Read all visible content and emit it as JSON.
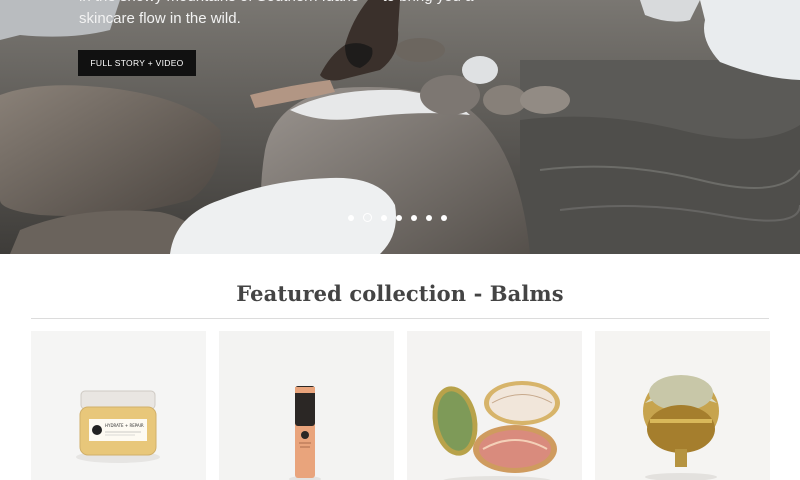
{
  "hero": {
    "text_line1": "in the snowy mountains of Southern Idaho — to bring you a",
    "text_line2": "skincare flow in the wild.",
    "button_label": "FULL STORY + VIDEO",
    "slides_total": 7,
    "active_slide": 2
  },
  "featured": {
    "title": "Featured collection - Balms",
    "products": [
      {
        "name": "Hydrate + Repair balm jar",
        "jar_label": "HYDRATE + REPAIR"
      },
      {
        "name": "Balm stick",
        "stick_label": "BALM STICK"
      },
      {
        "name": "Open shell balm compacts"
      },
      {
        "name": "Shell balm compact"
      }
    ]
  }
}
